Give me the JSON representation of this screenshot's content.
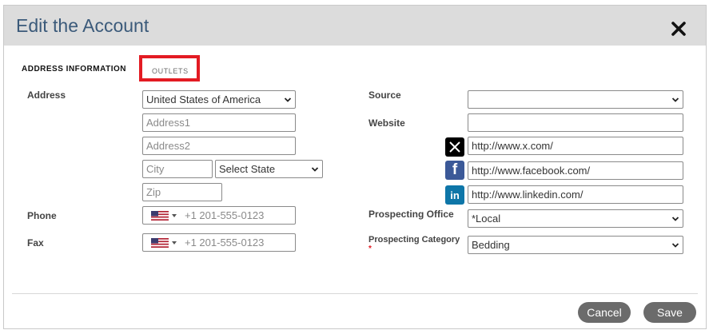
{
  "dialog": {
    "title": "Edit the Account"
  },
  "tabs": {
    "address_information": "ADDRESS INFORMATION",
    "outlets": "OUTLETS"
  },
  "address": {
    "label": "Address",
    "country": "United States of America",
    "address1_placeholder": "Address1",
    "address2_placeholder": "Address2",
    "city_placeholder": "City",
    "state_placeholder": "Select State",
    "zip_placeholder": "Zip"
  },
  "phone": {
    "label": "Phone",
    "placeholder": "+1 201-555-0123"
  },
  "fax": {
    "label": "Fax",
    "placeholder": "+1 201-555-0123"
  },
  "source": {
    "label": "Source",
    "value": ""
  },
  "website": {
    "label": "Website",
    "value": ""
  },
  "social": {
    "x_value": "http://www.x.com/",
    "facebook_value": "http://www.facebook.com/",
    "linkedin_value": "http://www.linkedin.com/"
  },
  "prospecting_office": {
    "label": "Prospecting Office",
    "value": "*Local"
  },
  "prospecting_category": {
    "label": "Prospecting Category",
    "required_mark": "*",
    "value": "Bedding"
  },
  "buttons": {
    "cancel": "Cancel",
    "save": "Save"
  },
  "colors": {
    "title": "#3b5a7a",
    "highlight": "#e31b23",
    "button": "#6b6b6b",
    "facebook": "#3b5998",
    "linkedin": "#0e76a8",
    "x": "#000000"
  }
}
